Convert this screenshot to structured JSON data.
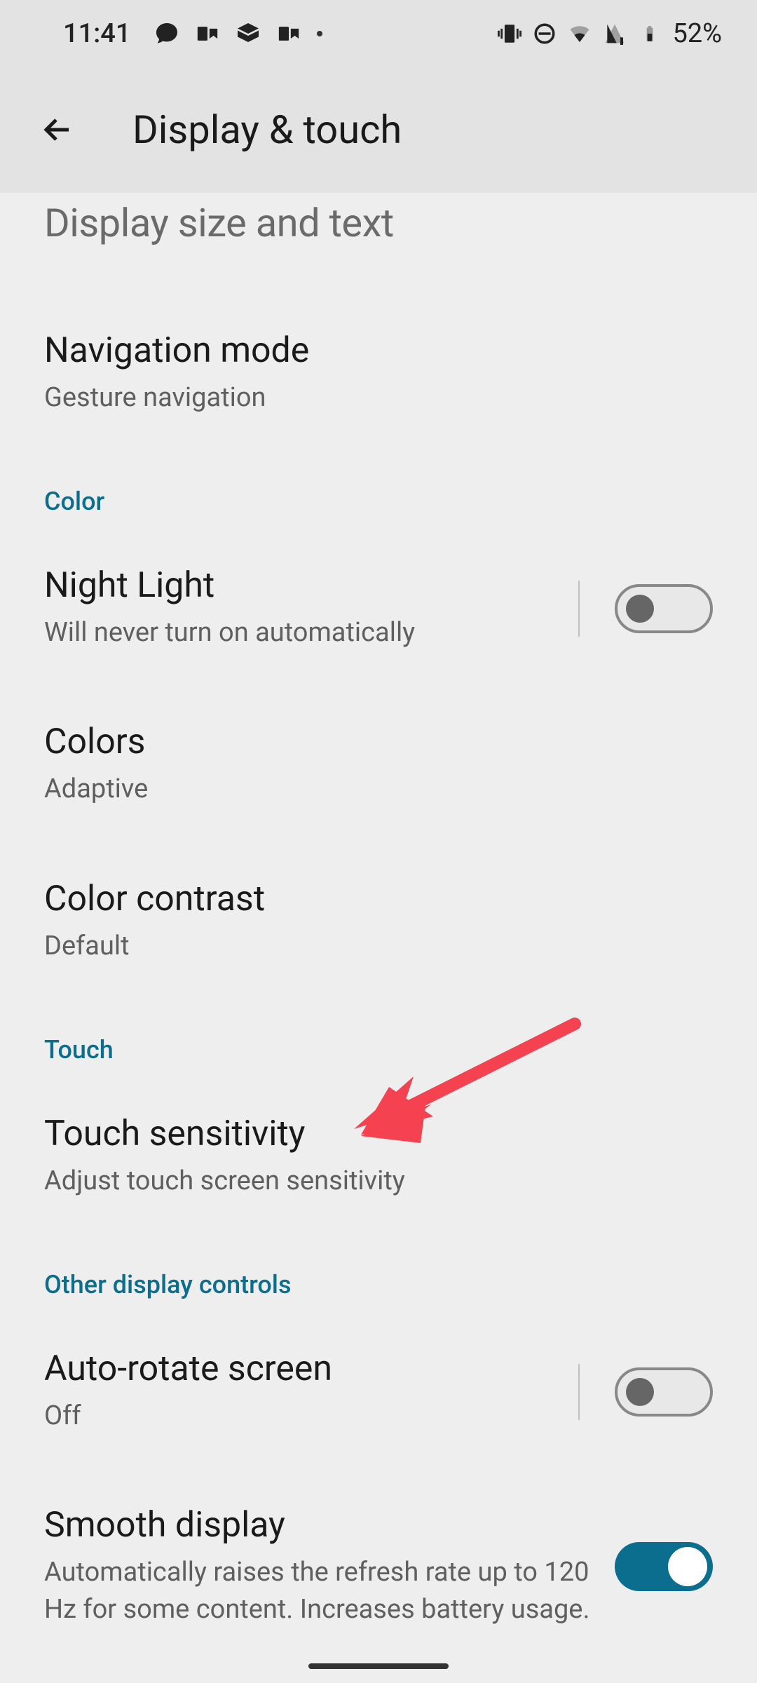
{
  "statusBar": {
    "time": "11:41",
    "battery": "52%"
  },
  "header": {
    "title": "Display & touch"
  },
  "partialItem": {
    "title": "Display size and text"
  },
  "items": {
    "navMode": {
      "title": "Navigation mode",
      "subtitle": "Gesture navigation"
    },
    "nightLight": {
      "title": "Night Light",
      "subtitle": "Will never turn on automatically"
    },
    "colors": {
      "title": "Colors",
      "subtitle": "Adaptive"
    },
    "colorContrast": {
      "title": "Color contrast",
      "subtitle": "Default"
    },
    "touchSensitivity": {
      "title": "Touch sensitivity",
      "subtitle": "Adjust touch screen sensitivity"
    },
    "autoRotate": {
      "title": "Auto-rotate screen",
      "subtitle": "Off"
    },
    "smoothDisplay": {
      "title": "Smooth display",
      "subtitle": "Automatically raises the refresh rate up to 120 Hz for some content. Increases battery usage."
    }
  },
  "sections": {
    "color": "Color",
    "touch": "Touch",
    "other": "Other display controls"
  }
}
